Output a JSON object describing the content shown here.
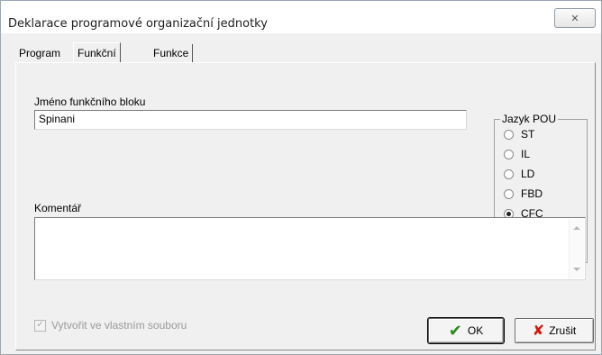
{
  "window": {
    "title": "Deklarace programové organizační jednotky",
    "close_glyph": "✕"
  },
  "tabs": [
    {
      "label": "Program",
      "active": false
    },
    {
      "label": "Funkční Blok",
      "active": true
    },
    {
      "label": "Funkce",
      "active": false
    }
  ],
  "form": {
    "name_label": "Jméno funkčního bloku",
    "name_value": "Spinani",
    "comment_label": "Komentář",
    "comment_value": "",
    "create_file_label": "Vytvořit ve vlastním souboru",
    "create_file_checked": true,
    "create_file_enabled": false
  },
  "language_group": {
    "title": "Jazyk POU",
    "options": [
      {
        "label": "ST",
        "checked": false
      },
      {
        "label": "IL",
        "checked": false
      },
      {
        "label": "LD",
        "checked": false
      },
      {
        "label": "FBD",
        "checked": false
      },
      {
        "label": "CFC",
        "checked": true
      }
    ]
  },
  "buttons": {
    "ok_label": "OK",
    "cancel_label": "Zrušit"
  },
  "colors": {
    "ok_icon": "#2d8a1f",
    "cancel_icon": "#d01a10"
  }
}
